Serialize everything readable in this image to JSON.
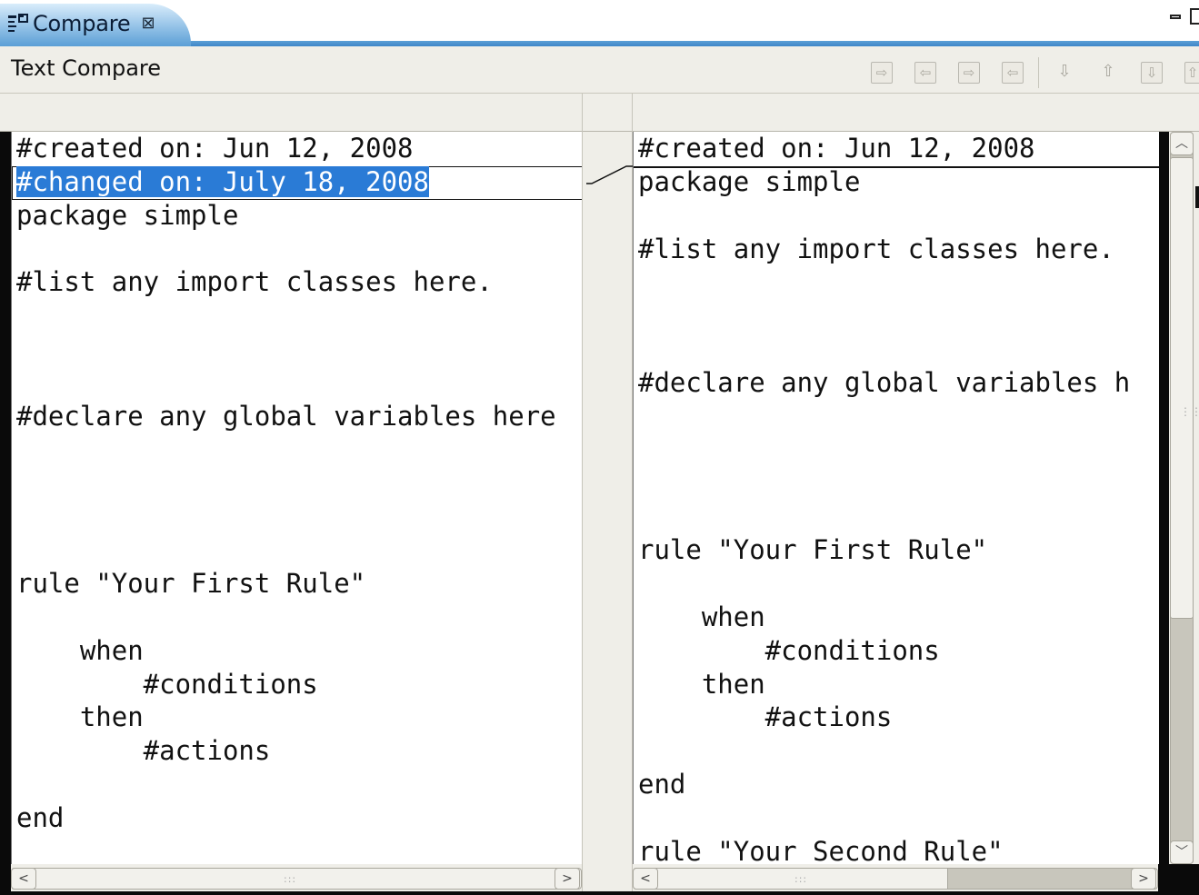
{
  "tab": {
    "label": "Compare",
    "close_symbol": "⊠",
    "icon": "compare-editor-icon"
  },
  "header": {
    "title": "Text Compare"
  },
  "toolbar": {
    "buttons": [
      {
        "icon": "copy-all-left-to-right-icon"
      },
      {
        "icon": "copy-all-right-to-left-icon"
      },
      {
        "icon": "copy-current-left-to-right-icon"
      },
      {
        "icon": "copy-current-right-to-left-icon"
      },
      {
        "icon": "next-difference-icon"
      },
      {
        "icon": "previous-difference-icon"
      },
      {
        "icon": "next-change-icon"
      },
      {
        "icon": "previous-change-icon"
      }
    ]
  },
  "left_pane": {
    "lines": [
      "#created on: Jun 12, 2008",
      "#changed on: July 18, 2008",
      "package simple",
      "",
      "#list any import classes here.",
      "",
      "",
      "",
      "#declare any global variables here",
      "",
      "",
      "",
      "",
      "rule \"Your First Rule\"",
      "",
      "    when",
      "        #conditions",
      "    then",
      "        #actions",
      "",
      "end"
    ],
    "highlighted_line_index": 1
  },
  "right_pane": {
    "lines": [
      "#created on: Jun 12, 2008",
      "package simple",
      "",
      "#list any import classes here.",
      "",
      "",
      "",
      "#declare any global variables h",
      "",
      "",
      "",
      "",
      "rule \"Your First Rule\"",
      "",
      "    when",
      "        #conditions",
      "    then",
      "        #actions",
      "",
      "end",
      "",
      "rule \"Your Second Rule\""
    ]
  },
  "scrollbars": {
    "left_arrow": "<",
    "right_arrow": ">",
    "up_arrow": "^",
    "down_arrow": "v",
    "grip": ":::"
  },
  "colors": {
    "highlight": "#2a7bd6",
    "tab_gradient_end": "#5b9fd6",
    "panel_bg": "#efeee8"
  }
}
